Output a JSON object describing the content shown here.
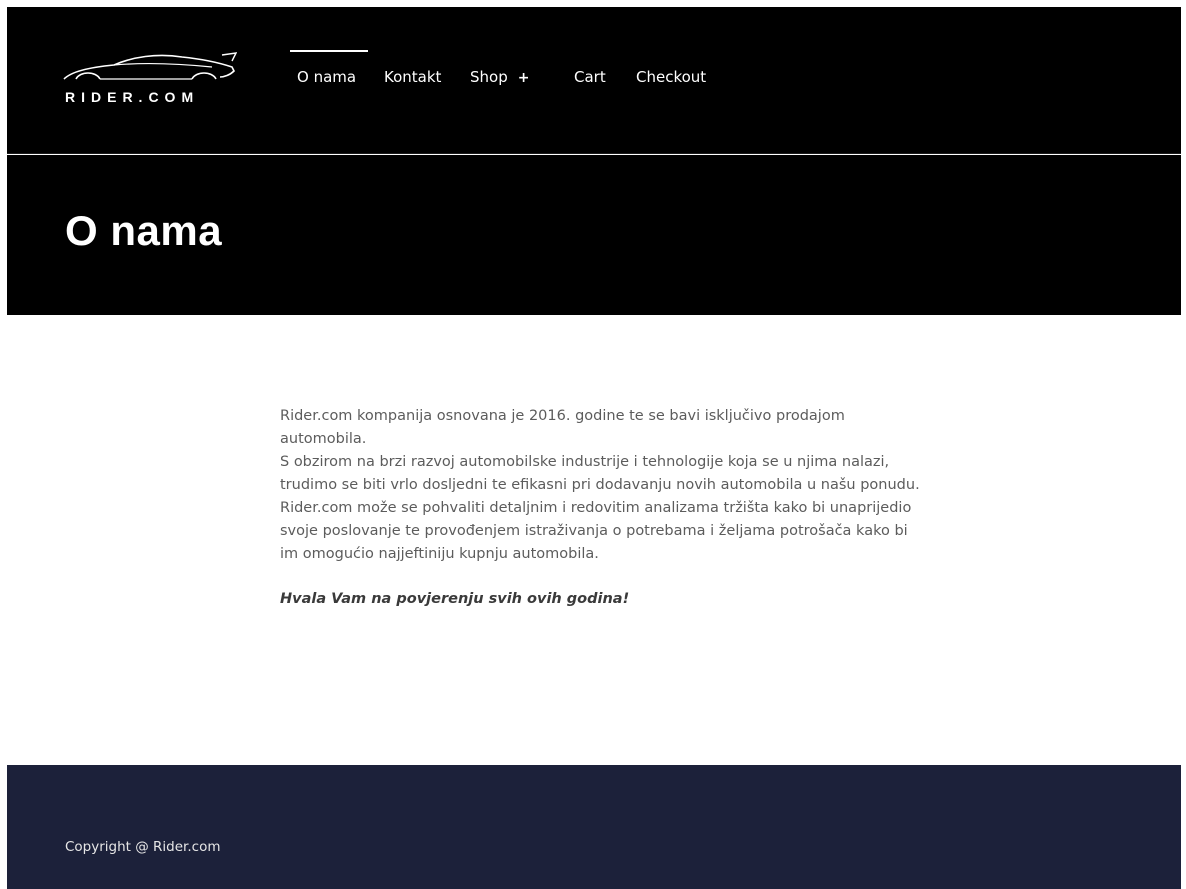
{
  "header": {
    "logo_text": "RIDER.COM",
    "nav": [
      {
        "label": "O nama",
        "active": true
      },
      {
        "label": "Kontakt",
        "active": false
      },
      {
        "label": "Shop",
        "active": false,
        "has_submenu": true,
        "submenu_icon": "+"
      },
      {
        "label": "Cart",
        "active": false
      },
      {
        "label": "Checkout",
        "active": false
      }
    ]
  },
  "page": {
    "title": "O nama",
    "paragraphs": [
      "Rider.com kompanija osnovana je 2016. godine te se bavi isključivo prodajom automobila.",
      "S obzirom na brzi razvoj automobilske industrije i tehnologije koja se u njima nalazi, trudimo se biti vrlo dosljedni te efikasni pri dodavanju novih automobila u našu ponudu.",
      "Rider.com može se pohvaliti detaljnim i redovitim analizama tržišta kako bi unaprijedio svoje poslovanje te provođenjem istraživanja o potrebama i željama potrošača kako bi im omogućio najjeftiniju kupnju automobila."
    ],
    "thanks": "Hvala Vam na povjerenju svih ovih godina!"
  },
  "footer": {
    "copyright": "Copyright @ Rider.com"
  },
  "colors": {
    "header_bg": "#000000",
    "footer_bg": "#1c213a",
    "text": "#5c5c5c"
  }
}
